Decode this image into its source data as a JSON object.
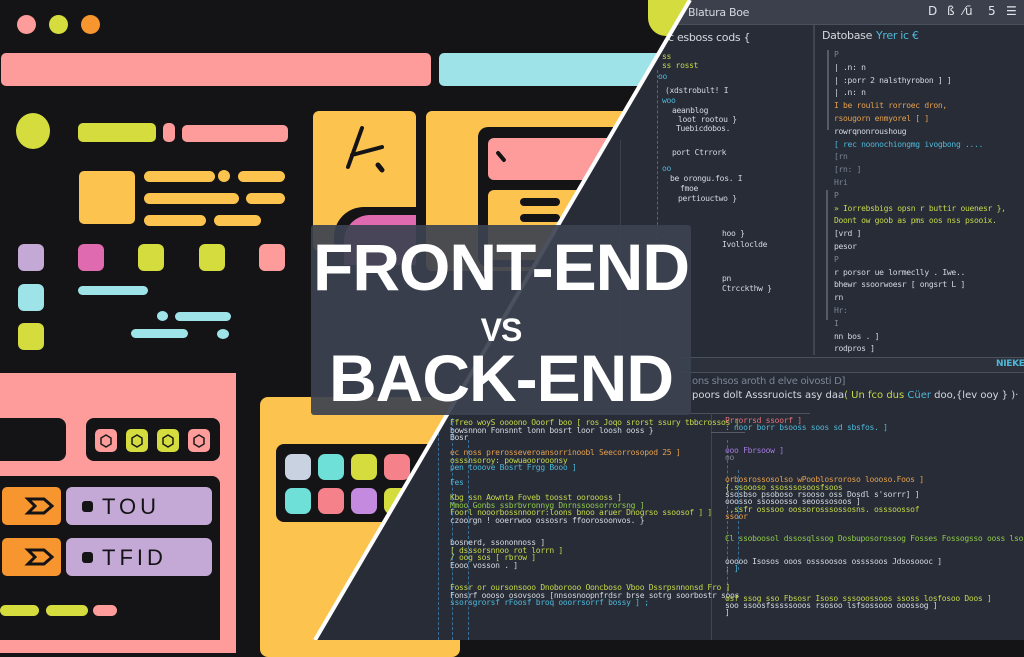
{
  "title": {
    "line1": "FRONT-END",
    "line2": "VS",
    "line3": "BACK-END"
  },
  "colors": {
    "background_left": "#141416",
    "background_right": "#272c37",
    "pink": "#fd9c9a",
    "cyan": "#9ee3e8",
    "yellow": "#fcc34f",
    "lime": "#d4dc3e",
    "orange": "#f7962f",
    "lavender": "#c4a9d6",
    "magenta": "#e06ab0",
    "title_box": "#3c4250",
    "divider": "#ffffff"
  },
  "front_end": {
    "window_controls": [
      "close-dot",
      "minimize-dot",
      "maximize-dot"
    ],
    "list_items": [
      {
        "label": "TOU",
        "icon": "chevron-right-icon"
      },
      {
        "label": "TFID",
        "icon": "chevron-right-icon"
      }
    ],
    "hex_icons": [
      "hexagon-icon",
      "hexagon-icon",
      "hexagon-icon",
      "hexagon-icon"
    ]
  },
  "back_end": {
    "editor_title": "Blatura Boe",
    "toolbar_icons": [
      "play-icon",
      "gear-icon",
      "chart-icon",
      "refresh-icon",
      "menu-icon"
    ],
    "left_pane": {
      "header": "c esboss cods {",
      "lines": [
        {
          "text": "ss",
          "cls": "c-y"
        },
        {
          "text": "ss rosst",
          "cls": "c-y"
        },
        {
          "text": "oo",
          "cls": "c-b"
        },
        {
          "text": "(xdstrobult! I",
          "cls": "c-w"
        },
        {
          "text": "woo",
          "cls": "c-b"
        },
        {
          "text": "aeanblog",
          "cls": "c-w"
        },
        {
          "text": "loot rootou }",
          "cls": "c-w"
        },
        {
          "text": "Tuebicdobos.",
          "cls": "c-w"
        },
        {
          "text": "port Ctrrork",
          "cls": "c-w"
        },
        {
          "text": "oo",
          "cls": "c-b"
        },
        {
          "text": "be orongu.fos.  I",
          "cls": "c-w"
        },
        {
          "text": "fmoe",
          "cls": "c-w"
        },
        {
          "text": "pertiouctwo }",
          "cls": "c-w"
        },
        {
          "text": "hoo }",
          "cls": "c-w"
        },
        {
          "text": "Ivolloclde",
          "cls": "c-w"
        },
        {
          "text": "pn",
          "cls": "c-w"
        },
        {
          "text": "Ctrcckthw }",
          "cls": "c-w"
        }
      ]
    },
    "right_pane": {
      "header_white": "Datobase",
      "header_accent": "Yrer ic €",
      "lines": [
        {
          "text": "P",
          "cls": "c-dim"
        },
        {
          "text": "| .n: n",
          "cls": "c-w"
        },
        {
          "text": "| :porr 2 nalsthyrobon ]  ]",
          "cls": "c-w"
        },
        {
          "text": "| .n: n",
          "cls": "c-w"
        },
        {
          "text": "I  be roulit  rorroec dron,",
          "cls": "c-o"
        },
        {
          "text": "     rsougorn enmyorel [  ]",
          "cls": "c-o"
        },
        {
          "text": "         rowrqnonroushoug",
          "cls": "c-w"
        },
        {
          "text": "         [ rec noonochiongmg ivogbong  ....",
          "cls": "c-b"
        },
        {
          "text": "      [rn",
          "cls": "c-dim"
        },
        {
          "text": "  [rn: ]",
          "cls": "c-dim"
        },
        {
          "text": "Hri",
          "cls": "c-dim"
        },
        {
          "text": "  P",
          "cls": "c-dim"
        },
        {
          "text": "  » Iorrebsbigs opsn  r  buttir ouenesr },",
          "cls": "c-y"
        },
        {
          "text": "     Doont ow goob as pms oos nss psooix.",
          "cls": "c-y"
        },
        {
          "text": "       [vrd  ]",
          "cls": "c-w"
        },
        {
          "text": "     pesor",
          "cls": "c-w"
        },
        {
          "text": "  P",
          "cls": "c-dim"
        },
        {
          "text": "  r   porsor ue lormeclly   .  Iwe..",
          "cls": "c-w"
        },
        {
          "text": "      bhewr ssoorwoesr [  ongsrt L  ]",
          "cls": "c-w"
        },
        {
          "text": "      rn",
          "cls": "c-w"
        },
        {
          "text": "  Hr:",
          "cls": "c-dim"
        },
        {
          "text": "  I",
          "cls": "c-dim"
        },
        {
          "text": "  nn bos  . ]",
          "cls": "c-w"
        },
        {
          "text": "  rodpros  ]",
          "cls": "c-w"
        }
      ]
    },
    "status_label": "NIEKE",
    "console": {
      "line1": "ons shsos aroth d elve oivosti D]",
      "line2_white": "poors dolt  Asssruoicts asy daa",
      "line2_y": "( Un fco dus",
      "line2_b": " Cüer",
      "line2_tail": " doo,{lev ooy } )·"
    },
    "bottom_left_code": [
      {
        "text": "Ffreo woyS oooono  Ooorf  boo  [ ros  Joqo  srorst  ssury  tbbcrossos ]",
        "cls": "c-y"
      },
      {
        "text": "bowsnnon Fonsnnt  lonn  bosrt  loor  loosh  ooss }",
        "cls": "c-w"
      },
      {
        "text": "Bosr",
        "cls": "c-w"
      },
      {
        "text": "",
        "cls": "c-w"
      },
      {
        "text": "ec noss  prerosseveroansorrinoobl Seecorrosopod 25  ]",
        "cls": "c-o"
      },
      {
        "text": "osssnsoroy: powuaoorooonsy",
        "cls": "c-y"
      },
      {
        "text": "pen tooove Bosrt Frgg  Booo ]",
        "cls": "c-b"
      },
      {
        "text": "",
        "cls": "c-w"
      },
      {
        "text": "Fes",
        "cls": "c-b"
      },
      {
        "text": "",
        "cls": "c-w"
      },
      {
        "text": "Kbg ssn  Aownta  Foveb  toosst  ooroooss ]",
        "cls": "c-y"
      },
      {
        "text": "  Mmoo  Gonbs  ssbrbvronnyg  Dnrnssoosorrorsng    ]",
        "cls": "c-g"
      },
      {
        "text": "   Foorl  nooorbossnnoorr:loons  bnoo  aruer  Dnogrso  ssoosof ]  ]",
        "cls": "c-y"
      },
      {
        "text": "   czoorgn !  ooerrwoo  ossosrs  ffoorosoonvos.             }",
        "cls": "c-w"
      },
      {
        "text": "",
        "cls": "c-w"
      },
      {
        "text": "",
        "cls": "c-w"
      },
      {
        "text": "   bosnerd, ssononnoss ]",
        "cls": "c-w"
      },
      {
        "text": "   [      dsssorsnnoo  rot lorrn ]",
        "cls": "c-y"
      },
      {
        "text": "   /      oog sos [ rbrow ]",
        "cls": "c-y"
      },
      {
        "text": "   Eooo vosson  . ]",
        "cls": "c-w"
      },
      {
        "text": "",
        "cls": "c-w"
      },
      {
        "text": "",
        "cls": "c-w"
      },
      {
        "text": "   Fossr or oursonsooo  Dnoborooo  Ooncboso  Vboo  Dssrpsnnonsd  Fro ]",
        "cls": "c-y"
      },
      {
        "text": "   Fonsrf  oooso  osovsoos  [nnsosnoopnfrdsr  brse  sotrg soorbostr  soos",
        "cls": "c-w"
      },
      {
        "text": "ssorsgrorsf  rFoosf  broq  ooorrsorrf  bossy ]                     ;",
        "cls": "c-b"
      }
    ],
    "bottom_right_code": [
      {
        "text": "Prrorrsd  ssoorf ]",
        "cls": "c-p"
      },
      {
        "text": ": noor  borr  bsooss  soos  sd  sbsfos.     ]",
        "cls": "c-b"
      },
      {
        "text": "",
        "cls": "c-w"
      },
      {
        "text": "",
        "cls": "c-w"
      },
      {
        "text": "  ooo Fbrsoow     ]",
        "cls": "c-v"
      },
      {
        "text": "  oo",
        "cls": "c-dim"
      },
      {
        "text": "",
        "cls": "c-w"
      },
      {
        "text": "",
        "cls": "c-w"
      },
      {
        "text": "      orbosrossosolso  wPooblosroroso  loooso.Foos ]",
        "cls": "c-o"
      },
      {
        "text": "          {.ssoooso  ssosssosoosfsoos",
        "cls": "c-y"
      },
      {
        "text": "           ssosbso  psoboso  rsooso  oss  Dosdl  s'sorrr] ]",
        "cls": "c-w"
      },
      {
        "text": "           ooosso  ssosoosso  seoossosoos            ]",
        "cls": "c-w"
      },
      {
        "text": "        .,ssfr  osssoo  oossorosssossosns.  osssoossof",
        "cls": "c-y"
      },
      {
        "text": "      ssoor",
        "cls": "c-o"
      },
      {
        "text": "",
        "cls": "c-w"
      },
      {
        "text": "",
        "cls": "c-w"
      },
      {
        "text": "     Cl   ssoboosol  dssosqlssog  Dosbuposorossog  Fosses  Fossogsso  ooss  lsor  osssosso  ooossosso",
        "cls": "c-g"
      },
      {
        "text": "",
        "cls": "c-w"
      },
      {
        "text": "",
        "cls": "c-w"
      },
      {
        "text": "     ooooo  Isosos  ooos  osssoosos  ossssoos   Jdsosoooc    ]",
        "cls": "c-w"
      },
      {
        "text": "   ; ]",
        "cls": "c-b"
      },
      {
        "text": "",
        "cls": "c-w"
      },
      {
        "text": "",
        "cls": "c-w"
      },
      {
        "text": "",
        "cls": "c-w"
      },
      {
        "text": "  osf  ssog  sso  Fbsosr  Isoso  sssooossoos  ssoss  losfosoo  Doos ]",
        "cls": "c-y"
      },
      {
        "text": "  soo  ssoosfsssssooos  rsosoo  lsfsossooo  ooossog ]",
        "cls": "c-w"
      },
      {
        "text": "                                                  ]",
        "cls": "c-w"
      }
    ]
  }
}
